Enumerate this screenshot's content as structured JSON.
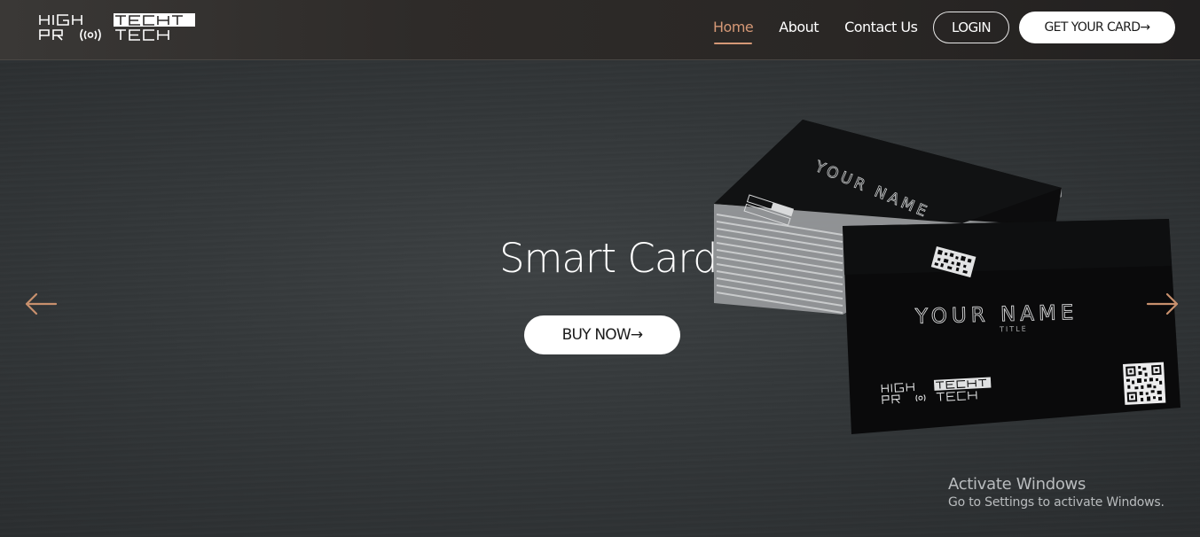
{
  "header": {
    "logo": {
      "line1_left": "HIGH",
      "line1_right": "TECH",
      "line2_left": "PRO",
      "line2_right": "TECH"
    },
    "nav": [
      {
        "label": "Home",
        "active": true
      },
      {
        "label": "About",
        "active": false
      },
      {
        "label": "Contact Us",
        "active": false
      }
    ],
    "login_label": "LOGIN",
    "cta_label": "GET YOUR CARD→"
  },
  "hero": {
    "title": "Smart Card",
    "button_label": "BUY NOW→",
    "prev_icon": "arrow-left-icon",
    "next_icon": "arrow-right-icon",
    "card_image": {
      "name_text": "YOUR NAME",
      "title_text": "TITLE",
      "logo_line1": "HIGH TECH",
      "logo_line2": "PRO TECH"
    }
  },
  "watermark": {
    "title": "Activate Windows",
    "subtitle": "Go to Settings to activate Windows."
  },
  "colors": {
    "accent": "#d59876",
    "nav_text": "#ffffff",
    "hero_bg": "#333739"
  }
}
